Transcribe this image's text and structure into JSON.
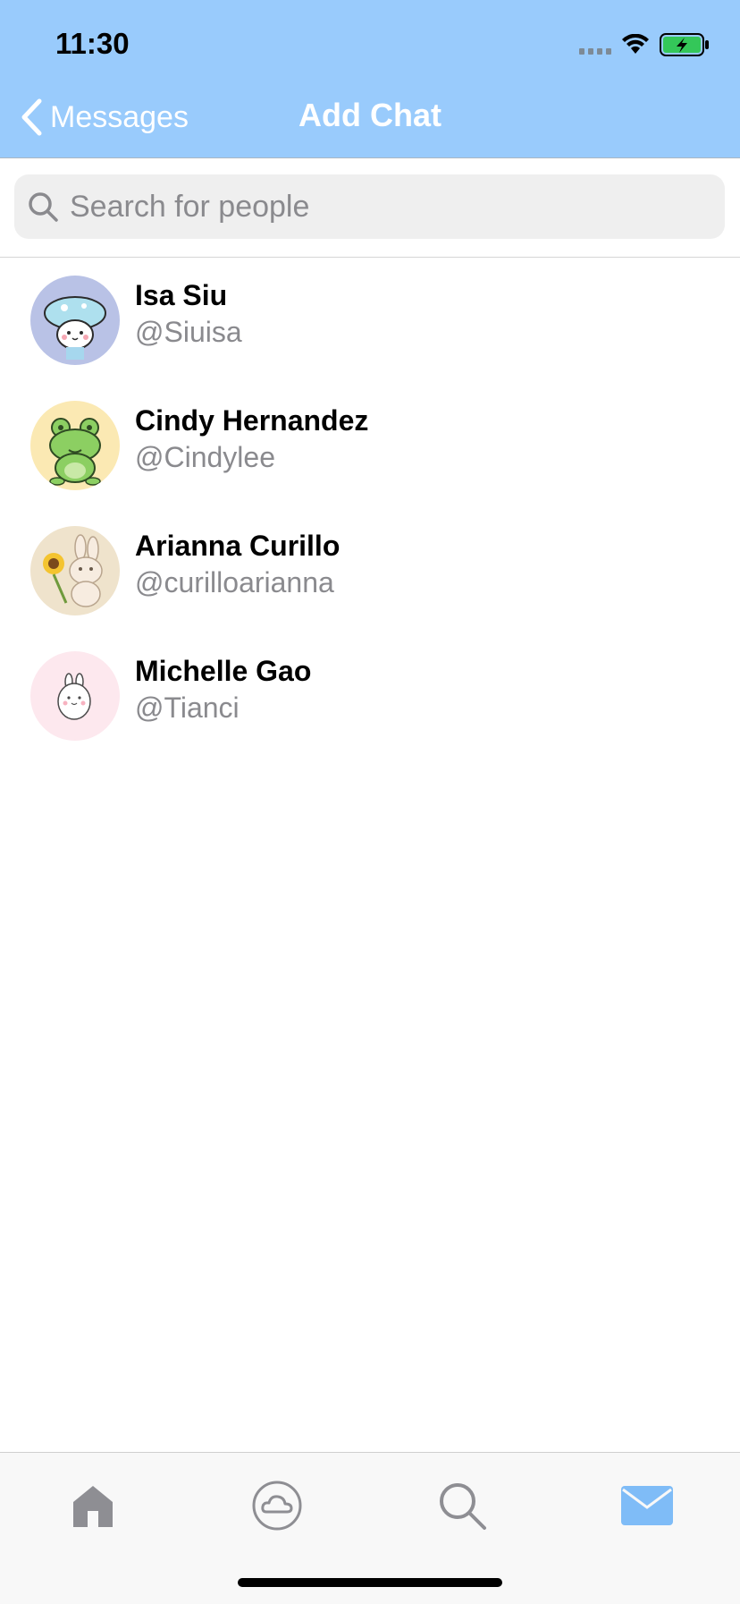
{
  "status_bar": {
    "time": "11:30"
  },
  "nav": {
    "back_label": "Messages",
    "title": "Add Chat"
  },
  "search": {
    "placeholder": "Search for people",
    "value": ""
  },
  "people": [
    {
      "name": "Isa Siu",
      "handle": "@Siuisa"
    },
    {
      "name": "Cindy Hernandez",
      "handle": "@Cindylee"
    },
    {
      "name": "Arianna Curillo",
      "handle": "@curilloarianna"
    },
    {
      "name": "Michelle Gao",
      "handle": "@Tianci"
    }
  ],
  "tab_bar": {
    "items": [
      {
        "icon": "home-icon",
        "active": false
      },
      {
        "icon": "cloud-icon",
        "active": false
      },
      {
        "icon": "search-icon",
        "active": false
      },
      {
        "icon": "mail-icon",
        "active": true
      }
    ]
  },
  "colors": {
    "header": "#99cbfc",
    "accent": "#7fbcf7",
    "inactive_icon": "#8e8e93",
    "battery": "#34c759"
  }
}
